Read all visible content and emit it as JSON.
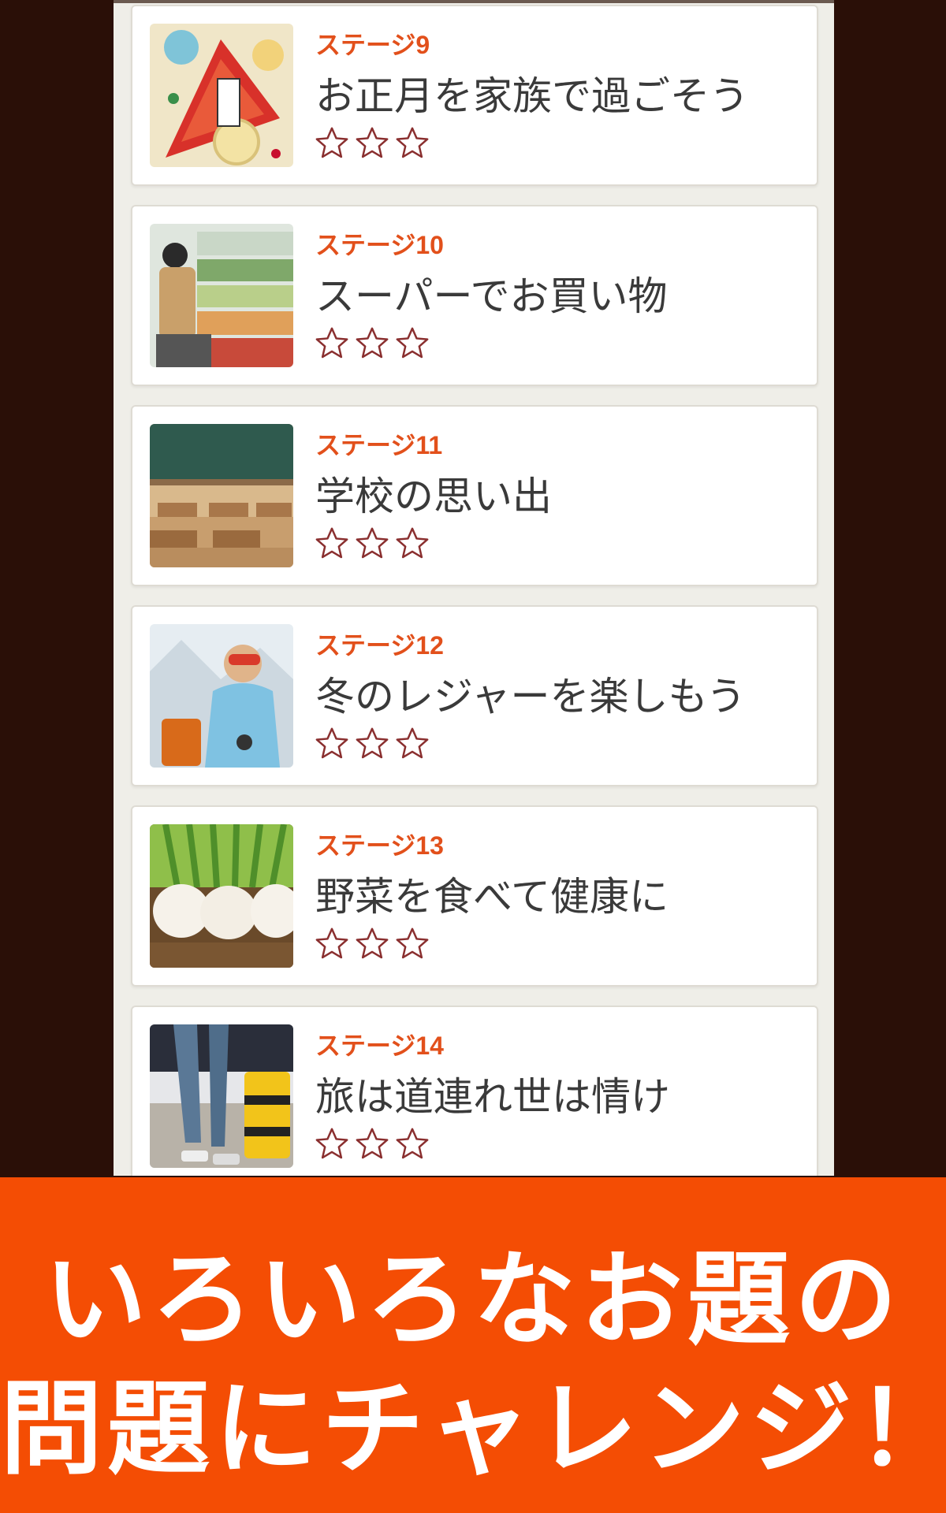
{
  "stages": [
    {
      "label": "ステージ9",
      "title": "お正月を家族で過ごそう",
      "stars": 0,
      "stars_max": 3,
      "image": "new-year-decoration"
    },
    {
      "label": "ステージ10",
      "title": "スーパーでお買い物",
      "stars": 0,
      "stars_max": 3,
      "image": "supermarket-shopping"
    },
    {
      "label": "ステージ11",
      "title": "学校の思い出",
      "stars": 0,
      "stars_max": 3,
      "image": "classroom"
    },
    {
      "label": "ステージ12",
      "title": "冬のレジャーを楽しもう",
      "stars": 0,
      "stars_max": 3,
      "image": "snowboarder"
    },
    {
      "label": "ステージ13",
      "title": "野菜を食べて健康に",
      "stars": 0,
      "stars_max": 3,
      "image": "turnips"
    },
    {
      "label": "ステージ14",
      "title": "旅は道連れ世は情け",
      "stars": 0,
      "stars_max": 3,
      "image": "traveler-suitcase"
    }
  ],
  "banner": {
    "line1": "いろいろなお題の",
    "line2": "問題にチャレンジ！"
  },
  "colors": {
    "accent": "#e2501b",
    "banner": "#f44d04",
    "background": "#2a0f07",
    "star_outline": "#8a2f2f"
  }
}
